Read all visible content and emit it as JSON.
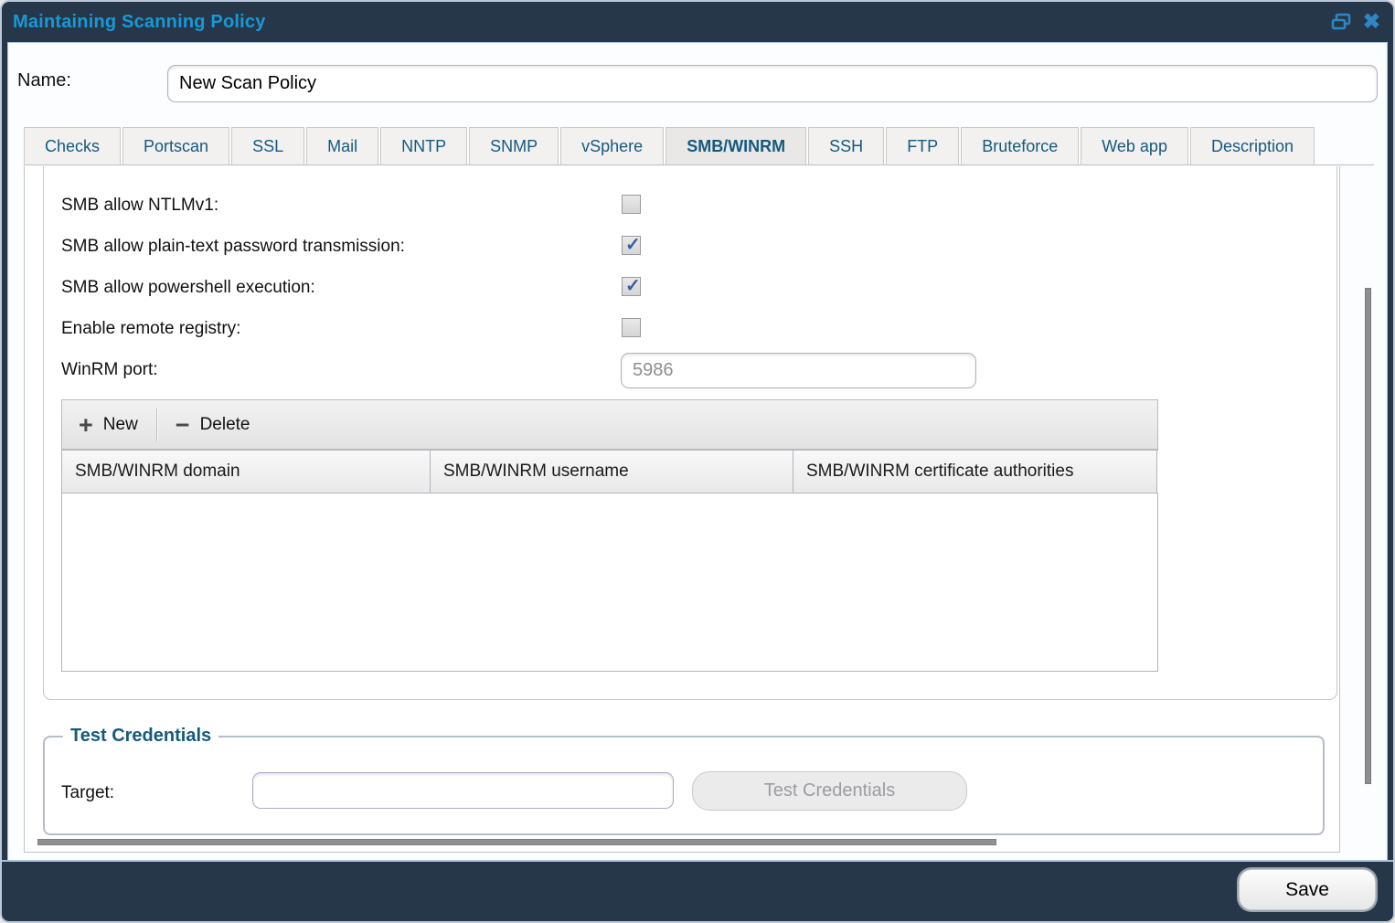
{
  "window": {
    "title": "Maintaining Scanning Policy"
  },
  "name_field": {
    "label": "Name:",
    "value": "New Scan Policy"
  },
  "tabs": [
    {
      "label": "Checks",
      "active": false
    },
    {
      "label": "Portscan",
      "active": false
    },
    {
      "label": "SSL",
      "active": false
    },
    {
      "label": "Mail",
      "active": false
    },
    {
      "label": "NNTP",
      "active": false
    },
    {
      "label": "SNMP",
      "active": false
    },
    {
      "label": "vSphere",
      "active": false
    },
    {
      "label": "SMB/WINRM",
      "active": true
    },
    {
      "label": "SSH",
      "active": false
    },
    {
      "label": "FTP",
      "active": false
    },
    {
      "label": "Bruteforce",
      "active": false
    },
    {
      "label": "Web app",
      "active": false
    },
    {
      "label": "Description",
      "active": false
    }
  ],
  "form": {
    "checkboxes": [
      {
        "label": "SMB allow NTLMv1:",
        "checked": false
      },
      {
        "label": "SMB allow plain-text password transmission:",
        "checked": true
      },
      {
        "label": "SMB allow powershell execution:",
        "checked": true
      },
      {
        "label": "Enable remote registry:",
        "checked": false
      }
    ],
    "winrm_port": {
      "label": "WinRM port:",
      "value": "5986"
    }
  },
  "credentials_table": {
    "toolbar": {
      "new_label": "New",
      "delete_label": "Delete",
      "new_icon": "plus-icon",
      "delete_icon": "minus-icon"
    },
    "columns": [
      "SMB/WINRM domain",
      "SMB/WINRM username",
      "SMB/WINRM certificate authorities"
    ],
    "rows": []
  },
  "test_credentials": {
    "legend": "Test Credentials",
    "target_label": "Target:",
    "target_value": "",
    "button_label": "Test Credentials",
    "button_enabled": false
  },
  "footer": {
    "save_label": "Save"
  },
  "colors": {
    "titlebar_bg": "#27374a",
    "title_text": "#1899d5",
    "tab_text": "#15597f",
    "check_blue": "#3a5f9f",
    "control_icon_blue": "#2e86c2"
  }
}
